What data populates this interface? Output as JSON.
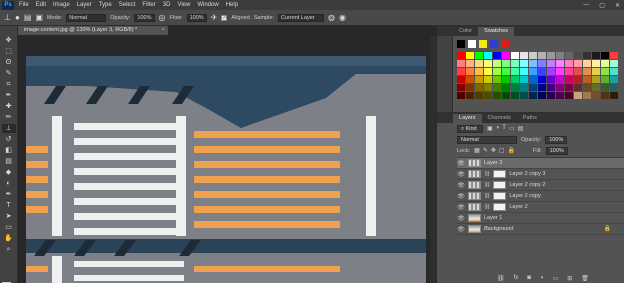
{
  "menu": {
    "app_logo": "Ps",
    "items": [
      "File",
      "Edit",
      "Image",
      "Layer",
      "Type",
      "Select",
      "Filter",
      "3D",
      "View",
      "Window",
      "Help"
    ],
    "window_controls": [
      "—",
      "▢",
      "✕"
    ]
  },
  "options_bar": {
    "tool_icon": "clone-stamp-icon",
    "mode_label": "Mode:",
    "mode_value": "Normal",
    "opacity_label": "Opacity:",
    "opacity_value": "100%",
    "flow_label": "Flow:",
    "flow_value": "100%",
    "aligned_label": "Aligned",
    "aligned_checked": true,
    "sample_label": "Sample:",
    "sample_value": "Current Layer"
  },
  "toolbar": {
    "tools": [
      "move-icon",
      "marquee-icon",
      "lasso-icon",
      "quick-select-icon",
      "crop-icon",
      "eyedropper-icon",
      "healing-brush-icon",
      "brush-icon",
      "clone-stamp-icon",
      "history-brush-icon",
      "eraser-icon",
      "gradient-icon",
      "blur-icon",
      "dodge-icon",
      "pen-icon",
      "type-icon",
      "path-select-icon",
      "rectangle-icon",
      "hand-icon",
      "zoom-icon"
    ],
    "tool_glyphs": [
      "✥",
      "⬚",
      "ʘ",
      "✎",
      "⌗",
      "✒",
      "✚",
      "✏",
      "⊥",
      "↺",
      "◧",
      "▤",
      "◆",
      "◐",
      "✒",
      "T",
      "➤",
      "▭",
      "✋",
      "⌕"
    ],
    "active_tool_index": 8,
    "foreground_color": "#f3e81c",
    "background_color": "#f2f2f2"
  },
  "document": {
    "tab_title": "image-content.jpg @ 130% (Layer 3, RGB/8) *",
    "close": "×"
  },
  "panels": {
    "top_tabs": [
      "Color",
      "Swatches"
    ],
    "active_top_tab": 1,
    "swatch_top_colors": [
      "#000000",
      "#ffffff",
      "#f3e81c",
      "#2d3dd6",
      "#e01a1a"
    ],
    "swatch_colors": [
      "#ff0000",
      "#ffff00",
      "#00ff00",
      "#00ffff",
      "#0000ff",
      "#ff00ff",
      "#ffffff",
      "#e6e6e6",
      "#cccccc",
      "#b3b3b3",
      "#999999",
      "#808080",
      "#666666",
      "#4d4d4d",
      "#333333",
      "#1a1a1a",
      "#000000",
      "#ff3b3b",
      "#ff7f7f",
      "#ffb27f",
      "#ffd97f",
      "#ffff7f",
      "#c3ff7f",
      "#7fff7f",
      "#7fffbf",
      "#7fffff",
      "#7fbfff",
      "#7f7fff",
      "#bf7fff",
      "#ff7fff",
      "#ff7fbf",
      "#ff9f9f",
      "#ffcf9f",
      "#ffef9f",
      "#dfff9f",
      "#9fffcf",
      "#ff4040",
      "#ff8040",
      "#ffbf40",
      "#ffff40",
      "#a0ff40",
      "#40ff40",
      "#40ffa0",
      "#40ffff",
      "#40a0ff",
      "#4040ff",
      "#a040ff",
      "#ff40ff",
      "#ff40a0",
      "#e05050",
      "#e09050",
      "#e0d050",
      "#90e050",
      "#50e0d0",
      "#cc0000",
      "#cc5200",
      "#cc9900",
      "#cccc00",
      "#66cc00",
      "#00cc00",
      "#00cc66",
      "#00cccc",
      "#0066cc",
      "#0000cc",
      "#6600cc",
      "#cc00cc",
      "#cc0066",
      "#b22222",
      "#c06020",
      "#b0a020",
      "#60b030",
      "#20a0a0",
      "#800000",
      "#803300",
      "#806600",
      "#808000",
      "#408000",
      "#008000",
      "#008040",
      "#008080",
      "#004080",
      "#000080",
      "#400080",
      "#800080",
      "#800040",
      "#5c2e2e",
      "#6b4a2a",
      "#6b6b2a",
      "#3a5e2a",
      "#2a5e5e",
      "#4d0000",
      "#4d1f00",
      "#4d3d00",
      "#4d4d00",
      "#264d00",
      "#004d00",
      "#004d26",
      "#004d4d",
      "#00264d",
      "#00004d",
      "#26004d",
      "#4d004d",
      "#4d0026",
      "#c8a27a",
      "#a07850",
      "#785028",
      "#503214",
      "#2d1c0c"
    ],
    "layers_tabs": [
      "Layers",
      "Channels",
      "Paths"
    ],
    "active_layers_tab": 0,
    "filter_value": "Kind",
    "blend_mode": "Normal",
    "opacity_label": "Opacity:",
    "opacity_value": "100%",
    "lock_label": "Lock:",
    "fill_label": "Fill:",
    "fill_value": "100%",
    "layers": [
      {
        "name": "Layer 3",
        "type": "pixel",
        "selected": true
      },
      {
        "name": "Layer 2 copy 3",
        "type": "masked",
        "selected": false
      },
      {
        "name": "Layer 2 copy 2",
        "type": "masked",
        "selected": false
      },
      {
        "name": "Layer 2 copy",
        "type": "masked",
        "selected": false
      },
      {
        "name": "Layer 2",
        "type": "masked",
        "selected": false
      },
      {
        "name": "Layer 1",
        "type": "photo",
        "selected": false
      },
      {
        "name": "Background",
        "type": "background",
        "selected": false
      }
    ],
    "bottom_icons": [
      "link-icon",
      "fx-icon",
      "mask-icon",
      "adjustment-icon",
      "group-icon",
      "new-layer-icon",
      "trash-icon"
    ],
    "bottom_glyphs": [
      "⛓",
      "fx",
      "◙",
      "◑",
      "▭",
      "⊞",
      "🗑"
    ]
  }
}
